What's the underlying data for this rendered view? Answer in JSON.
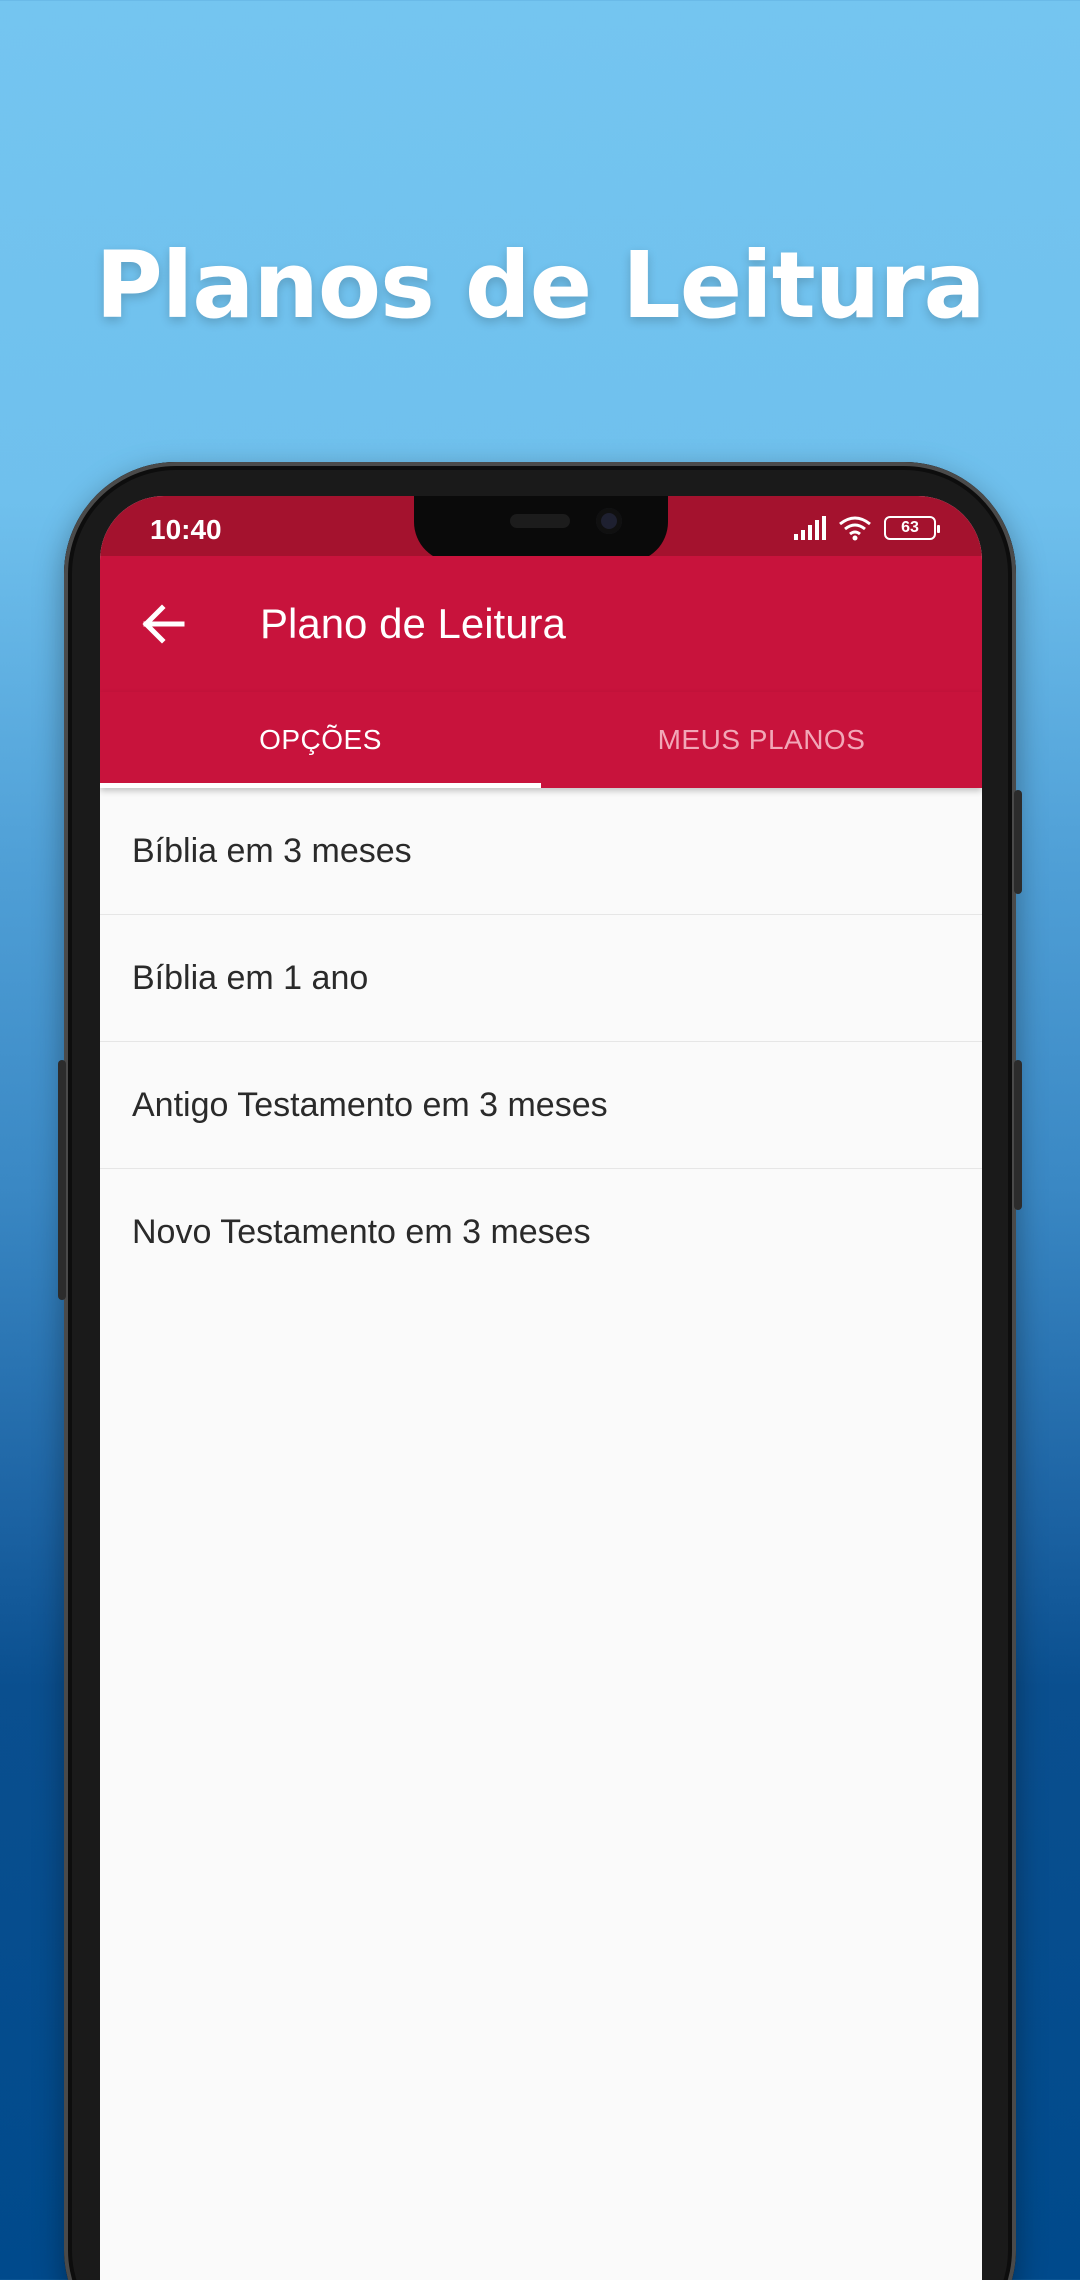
{
  "headline": "Planos de Leitura",
  "status_bar": {
    "time": "10:40",
    "battery": "63"
  },
  "app_bar": {
    "title": "Plano de Leitura",
    "back_icon": "arrow-left-icon"
  },
  "tabs": [
    {
      "label": "OPÇÕES",
      "selected": true
    },
    {
      "label": "MEUS PLANOS",
      "selected": false
    }
  ],
  "plans": [
    {
      "label": "Bíblia em 3 meses"
    },
    {
      "label": "Bíblia em 1 ano"
    },
    {
      "label": "Antigo Testamento em 3 meses"
    },
    {
      "label": "Novo Testamento em 3 meses"
    }
  ],
  "colors": {
    "app_bar": "#c8133c",
    "status_bar": "#a4122e",
    "inactive_tab_text": "#f2a7b7",
    "list_background": "#fafafa"
  }
}
